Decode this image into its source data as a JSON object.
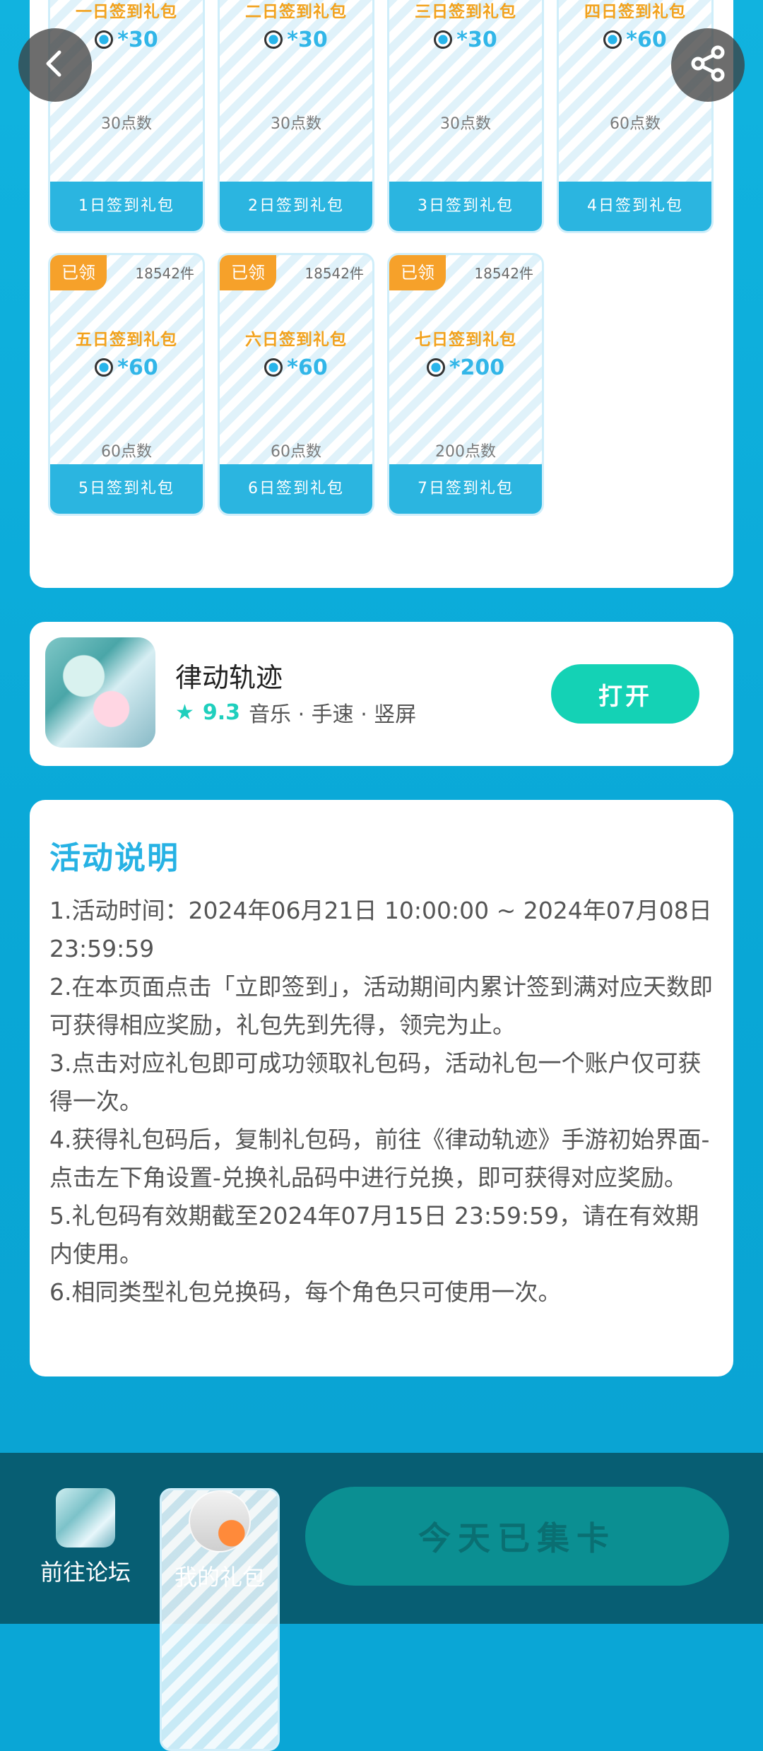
{
  "nav": {
    "back_icon": "back-arrow-icon",
    "share_icon": "share-icon"
  },
  "gifts": [
    {
      "title": "一日签到礼包",
      "reward": "*30",
      "points": "30点数",
      "button": "1日签到礼包",
      "claimed": false
    },
    {
      "title": "二日签到礼包",
      "reward": "*30",
      "points": "30点数",
      "button": "2日签到礼包",
      "claimed": false
    },
    {
      "title": "三日签到礼包",
      "reward": "*30",
      "points": "30点数",
      "button": "3日签到礼包",
      "claimed": false
    },
    {
      "title": "四日签到礼包",
      "reward": "*60",
      "points": "60点数",
      "button": "4日签到礼包",
      "claimed": false
    },
    {
      "title": "五日签到礼包",
      "reward": "*60",
      "points": "60点数",
      "button": "5日签到礼包",
      "claimed": true,
      "badge": "已领",
      "count": "18542件"
    },
    {
      "title": "六日签到礼包",
      "reward": "*60",
      "points": "60点数",
      "button": "6日签到礼包",
      "claimed": true,
      "badge": "已领",
      "count": "18542件"
    },
    {
      "title": "七日签到礼包",
      "reward": "*200",
      "points": "200点数",
      "button": "7日签到礼包",
      "claimed": true,
      "badge": "已领",
      "count": "18542件"
    }
  ],
  "game": {
    "name": "律动轨迹",
    "rating": "9.3",
    "tags": "音乐 · 手速 · 竖屏",
    "open_label": "打开"
  },
  "activity": {
    "title": "活动说明",
    "lines": [
      "1.活动时间：2024年06月21日 10:00:00 ~ 2024年07月08日 23:59:59",
      "2.在本页面点击「立即签到」，活动期间内累计签到满对应天数即可获得相应奖励，礼包先到先得，领完为止。",
      "3.点击对应礼包即可成功领取礼包码，活动礼包一个账户仅可获得一次。",
      "4.获得礼包码后，复制礼包码，前往《律动轨迹》手游初始界面-点击左下角设置-兑换礼品码中进行兑换，即可获得对应奖励。",
      "5.礼包码有效期截至2024年07月15日 23:59:59，请在有效期内使用。",
      "6.相同类型礼包兑换码，每个角色只可使用一次。"
    ]
  },
  "bottom": {
    "forum_label": "前往论坛",
    "gift_label": "我的礼包",
    "collect_label": "今天已集卡"
  }
}
